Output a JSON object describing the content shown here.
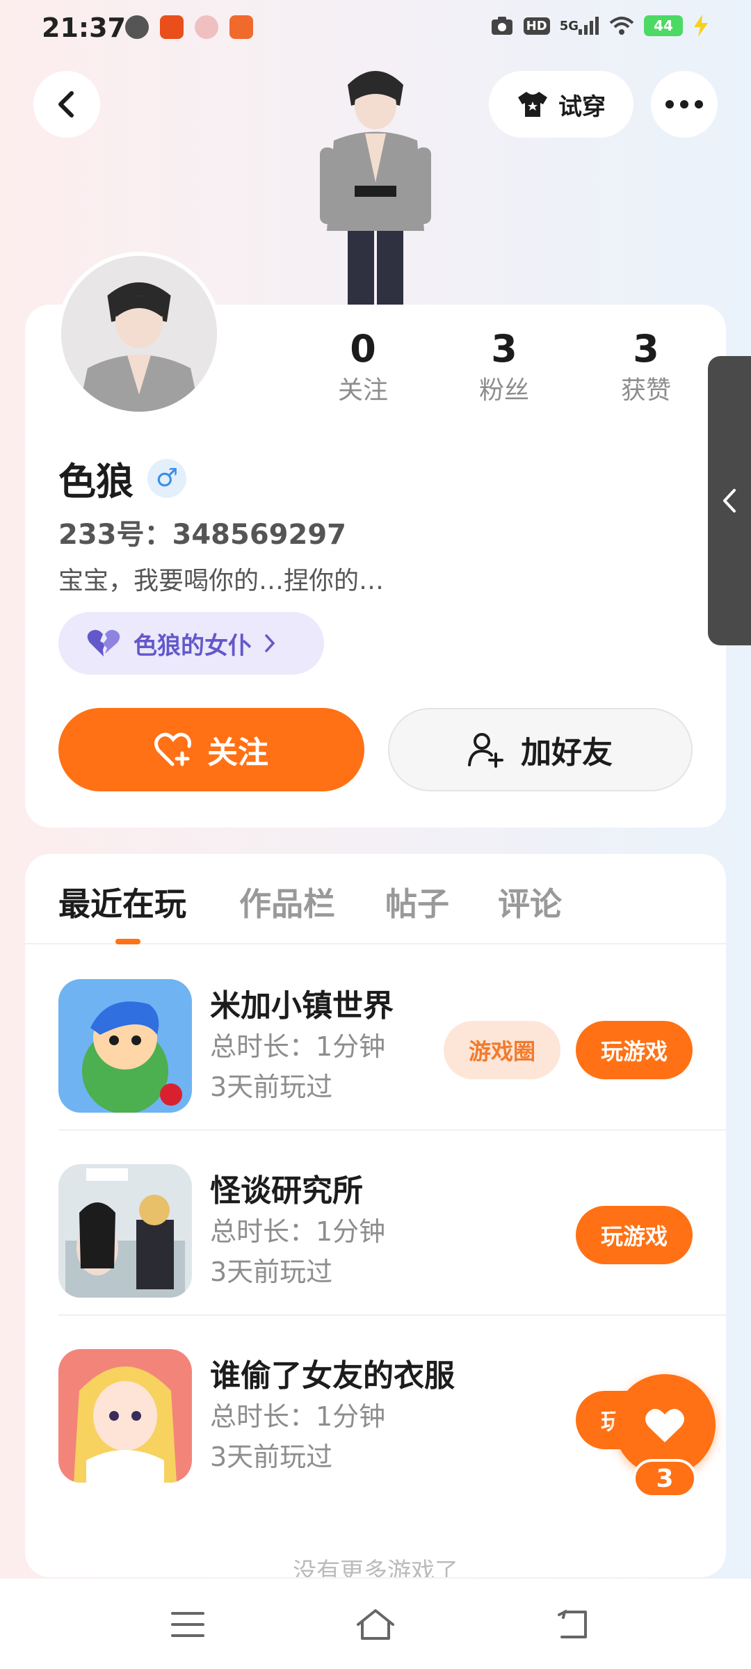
{
  "status_bar": {
    "time": "21:37",
    "signal_label": "5G",
    "hd_label": "HD",
    "battery": "44"
  },
  "header": {
    "try_on_label": "试穿"
  },
  "profile": {
    "stats": [
      {
        "value": "0",
        "label": "关注"
      },
      {
        "value": "3",
        "label": "粉丝"
      },
      {
        "value": "3",
        "label": "获赞"
      }
    ],
    "username": "色狼",
    "gender_symbol": "♂",
    "id_text": "233号：348569297",
    "bio": "宝宝，我要喝你的…捏你的…",
    "relation_chip": "色狼的女仆",
    "follow_label": "关注",
    "add_friend_label": "加好友"
  },
  "tabs": [
    "最近在玩",
    "作品栏",
    "帖子",
    "评论"
  ],
  "games": [
    {
      "name": "米加小镇世界",
      "duration": "总时长：1分钟",
      "last_played": "3天前玩过",
      "circle_label": "游戏圈",
      "play_label": "玩游戏"
    },
    {
      "name": "怪谈研究所",
      "duration": "总时长：1分钟",
      "last_played": "3天前玩过",
      "play_label": "玩游戏"
    },
    {
      "name": "谁偷了女友的衣服",
      "duration": "总时长：1分钟",
      "last_played": "3天前玩过",
      "play_label": "玩游戏"
    }
  ],
  "no_more_text": "没有更多游戏了",
  "like_count": "3",
  "colors": {
    "accent": "#ff7114",
    "chip_text": "#6358c9",
    "chip_bg": "#ebe9fb"
  }
}
